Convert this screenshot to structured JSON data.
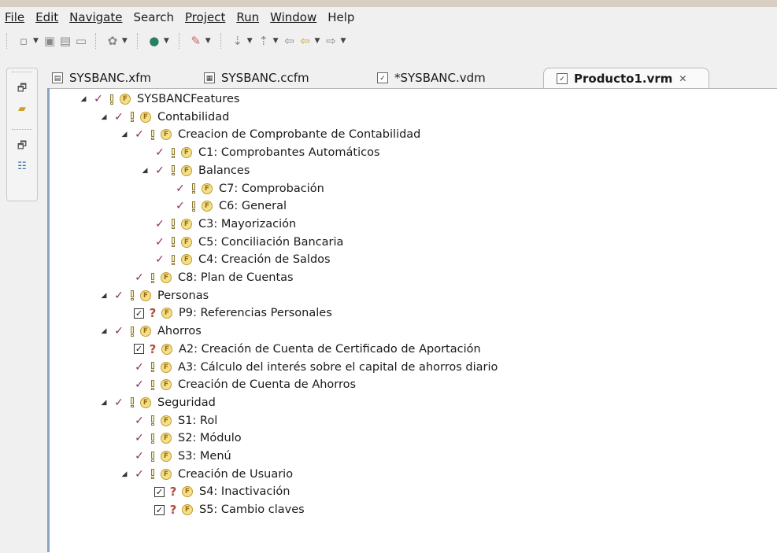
{
  "menu": [
    {
      "label": "File"
    },
    {
      "label": "Edit"
    },
    {
      "label": "Navigate"
    },
    {
      "label": "Search"
    },
    {
      "label": "Project"
    },
    {
      "label": "Run"
    },
    {
      "label": "Window"
    },
    {
      "label": "Help"
    }
  ],
  "tabs": [
    {
      "label": "SYSBANC.xfm",
      "active": false
    },
    {
      "label": "SYSBANC.ccfm",
      "active": false
    },
    {
      "label": "*SYSBANC.vdm",
      "active": false
    },
    {
      "label": "Producto1.vrm",
      "active": true,
      "close": "✕"
    }
  ],
  "tree": [
    {
      "label": "SYSBANCFeatures",
      "level": 0,
      "expanded": true,
      "state": "check",
      "kind": "mandatory"
    },
    {
      "label": "Contabilidad",
      "level": 1,
      "expanded": true,
      "state": "check",
      "kind": "mandatory"
    },
    {
      "label": "Creacion de Comprobante de Contabilidad",
      "level": 2,
      "expanded": true,
      "state": "check",
      "kind": "mandatory"
    },
    {
      "label": "C1: Comprobantes Automáticos",
      "level": 3,
      "expanded": false,
      "state": "check",
      "kind": "mandatory"
    },
    {
      "label": "Balances",
      "level": 3,
      "expanded": true,
      "state": "check",
      "kind": "mandatory"
    },
    {
      "label": "C7: Comprobación",
      "level": 4,
      "expanded": false,
      "state": "check",
      "kind": "mandatory"
    },
    {
      "label": "C6: General",
      "level": 4,
      "expanded": false,
      "state": "check",
      "kind": "mandatory"
    },
    {
      "label": "C3: Mayorización",
      "level": 3,
      "expanded": false,
      "state": "check",
      "kind": "mandatory"
    },
    {
      "label": "C5: Conciliación Bancaria",
      "level": 3,
      "expanded": false,
      "state": "check",
      "kind": "mandatory"
    },
    {
      "label": "C4: Creación de Saldos",
      "level": 3,
      "expanded": false,
      "state": "check",
      "kind": "mandatory"
    },
    {
      "label": "C8: Plan de Cuentas",
      "level": 2,
      "expanded": false,
      "state": "check",
      "kind": "mandatory"
    },
    {
      "label": "Personas",
      "level": 1,
      "expanded": true,
      "state": "check",
      "kind": "mandatory"
    },
    {
      "label": "P9: Referencias Personales",
      "level": 2,
      "expanded": false,
      "state": "box",
      "kind": "optional"
    },
    {
      "label": "Ahorros",
      "level": 1,
      "expanded": true,
      "state": "check",
      "kind": "mandatory"
    },
    {
      "label": "A2:  Creación de Cuenta de Certificado de Aportación",
      "level": 2,
      "expanded": false,
      "state": "box",
      "kind": "optional"
    },
    {
      "label": "A3: Cálculo del interés sobre el capital de ahorros diario",
      "level": 2,
      "expanded": false,
      "state": "check",
      "kind": "mandatory"
    },
    {
      "label": "Creación de Cuenta de Ahorros",
      "level": 2,
      "expanded": false,
      "state": "check",
      "kind": "mandatory"
    },
    {
      "label": "Seguridad",
      "level": 1,
      "expanded": true,
      "state": "check",
      "kind": "mandatory"
    },
    {
      "label": "S1: Rol",
      "level": 2,
      "expanded": false,
      "state": "check",
      "kind": "mandatory"
    },
    {
      "label": "S2: Módulo",
      "level": 2,
      "expanded": false,
      "state": "check",
      "kind": "mandatory"
    },
    {
      "label": "S3: Menú",
      "level": 2,
      "expanded": false,
      "state": "check",
      "kind": "mandatory"
    },
    {
      "label": "Creación de Usuario",
      "level": 2,
      "expanded": true,
      "state": "check",
      "kind": "mandatory"
    },
    {
      "label": "S4: Inactivación",
      "level": 3,
      "expanded": false,
      "state": "box",
      "kind": "optional"
    },
    {
      "label": "S5: Cambio claves",
      "level": 3,
      "expanded": false,
      "state": "box",
      "kind": "optional"
    }
  ],
  "colors": {
    "check": "#8b2d63",
    "optional": "#b24a3a",
    "feature": "#f3e08a"
  }
}
